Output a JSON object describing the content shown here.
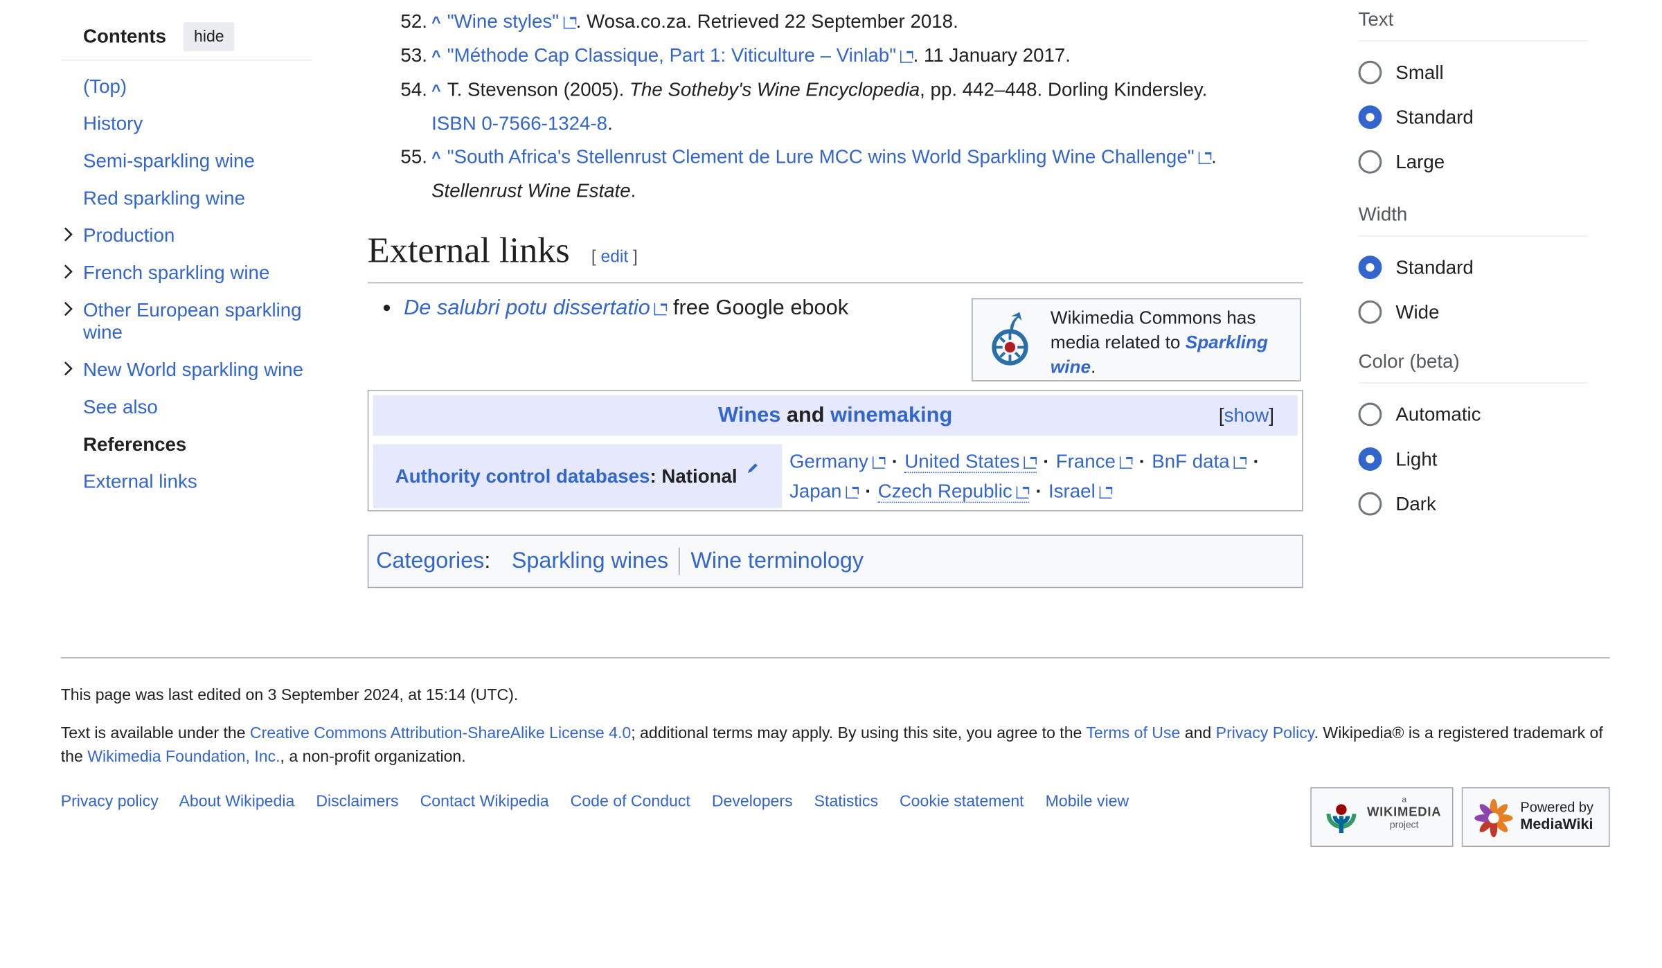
{
  "toc": {
    "title": "Contents",
    "hide": "hide",
    "items": [
      {
        "label": "(Top)"
      },
      {
        "label": "History"
      },
      {
        "label": "Semi-sparkling wine"
      },
      {
        "label": "Red sparkling wine"
      },
      {
        "label": "Production"
      },
      {
        "label": "French sparkling wine"
      },
      {
        "label": "Other European sparkling wine"
      },
      {
        "label": "New World sparkling wine"
      },
      {
        "label": "See also"
      },
      {
        "label": "References"
      },
      {
        "label": "External links"
      }
    ]
  },
  "references": [
    {
      "num": "52.",
      "link": "\"Wine styles\"",
      "rest": ". Wosa.co.za. Retrieved 22 September 2018."
    },
    {
      "num": "53.",
      "link": "\"Méthode Cap Classique, Part 1: Viticulture – Vinlab\"",
      "rest": ". 11 January 2017."
    },
    {
      "num": "54.",
      "pre": "T. Stevenson (2005). ",
      "italic": "The Sotheby's Wine Encyclopedia",
      "rest": ", pp. 442–448. Dorling Kindersley.",
      "isbn": "ISBN 0-7566-1324-8",
      "isbn_end": "."
    },
    {
      "num": "55.",
      "link": "\"South Africa's Stellenrust Clement de Lure MCC wins World Sparkling Wine Challenge\"",
      "rest": ".",
      "italic2": "Stellenrust Wine Estate",
      "end": "."
    }
  ],
  "external": {
    "heading": "External links",
    "edit_open": "[ ",
    "edit": "edit",
    "edit_close": " ]",
    "item_link": "De salubri potu dissertatio",
    "item_rest": " free Google ebook",
    "commons_text": "Wikimedia Commons has media related to ",
    "commons_link": "Sparkling wine",
    "commons_end": "."
  },
  "navbox": {
    "title_a": "Wines",
    "title_and": " and ",
    "title_b": "winemaking",
    "show_open": "[",
    "show": "show",
    "show_close": "]",
    "ac_label": "Authority control databases",
    "ac_suffix": ": National",
    "ac_items": [
      "Germany",
      "United States",
      "France",
      "BnF data",
      "Japan",
      "Czech Republic",
      "Israel"
    ],
    "separator": "·"
  },
  "categories": {
    "label": "Categories",
    "colon": ":",
    "items": [
      "Sparkling wines",
      "Wine terminology"
    ]
  },
  "panel": {
    "text": {
      "title": "Text",
      "options": [
        "Small",
        "Standard",
        "Large"
      ],
      "selected": "Standard"
    },
    "width": {
      "title": "Width",
      "options": [
        "Standard",
        "Wide"
      ],
      "selected": "Standard"
    },
    "color": {
      "title": "Color (beta)",
      "options": [
        "Automatic",
        "Light",
        "Dark"
      ],
      "selected": "Light"
    }
  },
  "footer": {
    "lastmod": "This page was last edited on 3 September 2024, at 15:14 (UTC).",
    "lic_1": "Text is available under the ",
    "lic_link1": "Creative Commons Attribution-ShareAlike License 4.0",
    "lic_2": "; additional terms may apply. By using this site, you agree to the ",
    "lic_link2": "Terms of Use",
    "lic_3": " and ",
    "lic_link3": "Privacy Policy",
    "lic_4": ". Wikipedia® is a registered trademark of the ",
    "lic_link4": "Wikimedia Foundation, Inc.",
    "lic_5": ", a non-profit organization.",
    "places": [
      "Privacy policy",
      "About Wikipedia",
      "Disclaimers",
      "Contact Wikipedia",
      "Code of Conduct",
      "Developers",
      "Statistics",
      "Cookie statement",
      "Mobile view"
    ],
    "badge1_small": "a",
    "badge1_big": "WIKIMEDIA",
    "badge1_sub": "project",
    "badge2_small": "Powered by",
    "badge2_big": "MediaWiki"
  },
  "colors": {
    "link": "#3366cc",
    "navbox_title_bg": "#e6e8fe",
    "radio_on": "#3366cc"
  }
}
